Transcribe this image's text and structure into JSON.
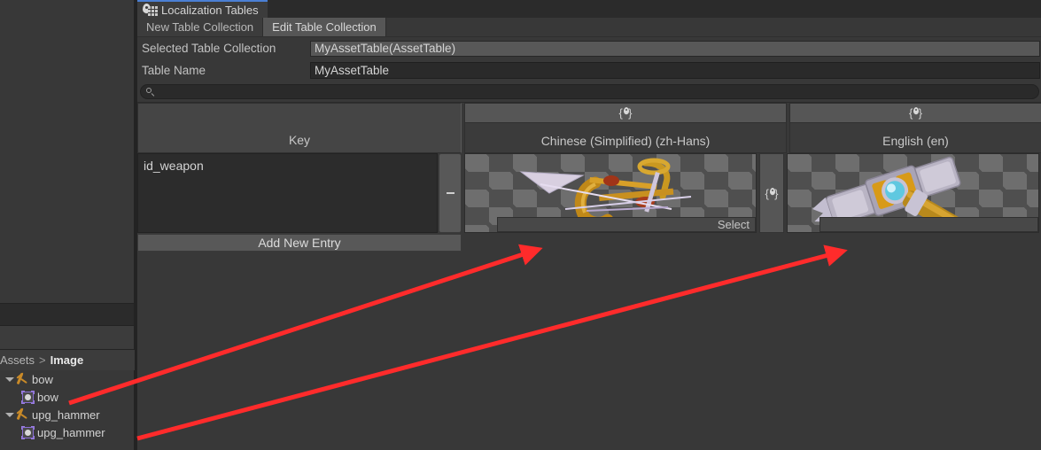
{
  "window": {
    "tab_title": "Localization Tables",
    "tab_icon": "pin-table-icon"
  },
  "toolbar": {
    "new_table_collection": "New Table Collection",
    "edit_table_collection": "Edit Table Collection",
    "active": "Edit Table Collection"
  },
  "properties": [
    {
      "label": "Selected Table Collection",
      "value": "MyAssetTable(AssetTable)",
      "type": "object"
    },
    {
      "label": "Table Name",
      "value": "MyAssetTable",
      "type": "text"
    }
  ],
  "search": {
    "value": "",
    "placeholder": "",
    "icon": "search-icon"
  },
  "table": {
    "columns": [
      {
        "id": "key",
        "label": "Key",
        "has_locale_button": false
      },
      {
        "id": "zh-Hans",
        "label": "Chinese (Simplified) (zh-Hans)",
        "has_locale_button": true,
        "button_icon": "locale-pin-icon"
      },
      {
        "id": "en",
        "label": "English (en)",
        "has_locale_button": true,
        "button_icon": "locale-pin-icon"
      }
    ],
    "rows": [
      {
        "key": "id_weapon",
        "remove_label": "-",
        "cells": [
          {
            "locale": "zh-Hans",
            "asset": "bow",
            "select_label": "Select"
          },
          {
            "locale": "en",
            "asset": "upg_hammer",
            "select_label": ""
          }
        ]
      }
    ],
    "add_entry_label": "Add New Entry"
  },
  "project": {
    "breadcrumb": {
      "root": "Assets",
      "separator": ">",
      "current": "Image"
    },
    "items": [
      {
        "label": "bow",
        "depth": 0,
        "icon": "weapon-thumb-icon",
        "expanded": true
      },
      {
        "label": "bow",
        "depth": 1,
        "icon": "sprite-icon",
        "expanded": false
      },
      {
        "label": "upg_hammer",
        "depth": 0,
        "icon": "weapon-thumb-icon",
        "expanded": true
      },
      {
        "label": "upg_hammer",
        "depth": 1,
        "icon": "sprite-icon",
        "expanded": false
      }
    ]
  },
  "annotations": {
    "arrow_color": "#ff2b2b",
    "arrows": [
      {
        "from_label": "bow",
        "to_label": "Chinese (Simplified) (zh-Hans) asset select"
      },
      {
        "from_label": "upg_hammer",
        "to_label": "English (en) asset select"
      }
    ]
  },
  "colors": {
    "window_bg": "#383838",
    "panel_bg": "#3c3c3c",
    "field_bg": "#2a2a2a",
    "button_bg": "#585858",
    "accent_tab": "#4b7fd4",
    "text": "#c8c8c8",
    "arrow": "#ff2b2b"
  }
}
